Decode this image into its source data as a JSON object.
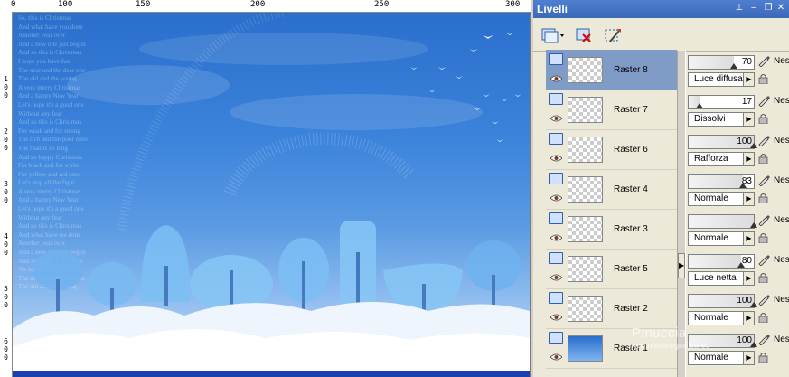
{
  "ruler": {
    "top_labels": [
      "0",
      "100",
      "150",
      "200",
      "250",
      "300"
    ],
    "left_labels": [
      "1\n0\n0",
      "2\n0\n0",
      "3\n0\n0",
      "4\n0\n0",
      "5\n0\n0",
      "6\n0\n0"
    ]
  },
  "canvas": {
    "poem_lines": [
      "So, this is Christmas",
      "And what have you done",
      "Another year over",
      "And a new one just begun",
      "And so this is Christmas",
      "I hope you have fun",
      "The near and the dear one",
      "The old and the young",
      "A very merry Christmas",
      "And a happy New Year",
      "Let's hope it's a good one",
      "Without any fear",
      "And so this is Christmas",
      "For weak and for strong",
      "The rich and the poor ones",
      "The road is so long",
      "And so happy Christmas",
      "For black and for white",
      "For yellow and red ones",
      "Let's stop all the fight",
      "A very merry Christmas",
      "And a happy New Year",
      "Let's hope it's a good one",
      "Without any fear",
      "And so this is Christmas",
      "And what have we done",
      "Another year over",
      "And a new one just begun",
      "And so happy Christmas",
      "We hope you have fun",
      "The near and the dear one",
      "The old and the young"
    ]
  },
  "panel": {
    "title": "Livelli",
    "toolbar": {
      "new_layer_icon": "new-layer-icon",
      "delete_icon": "delete-layer-icon",
      "edit_icon": "edit-selection-icon"
    },
    "layers": [
      {
        "name": "Raster 8",
        "selected": true,
        "opacity": "70",
        "opacity_value": 70,
        "blend": "Luce diffusa",
        "nes": "Nes",
        "thumb": "transparent"
      },
      {
        "name": "Raster 7",
        "selected": false,
        "opacity": "17",
        "opacity_value": 17,
        "blend": "Dissolvi",
        "nes": "Nes",
        "thumb": "transparent"
      },
      {
        "name": "Raster 6",
        "selected": false,
        "opacity": "100",
        "opacity_value": 100,
        "blend": "Rafforza",
        "nes": "Nes",
        "thumb": "transparent"
      },
      {
        "name": "Raster 4",
        "selected": false,
        "opacity": "83",
        "opacity_value": 83,
        "blend": "Normale",
        "nes": "Nes",
        "thumb": "transparent"
      },
      {
        "name": "Raster 3",
        "selected": false,
        "opacity": "",
        "opacity_value": 100,
        "blend": "Normale",
        "nes": "Nes",
        "thumb": "transparent"
      },
      {
        "name": "Raster 5",
        "selected": false,
        "opacity": "80",
        "opacity_value": 80,
        "blend": "Luce netta",
        "nes": "Nes",
        "thumb": "transparent"
      },
      {
        "name": "Raster 2",
        "selected": false,
        "opacity": "100",
        "opacity_value": 100,
        "blend": "Normale",
        "nes": "Nes",
        "thumb": "transparent"
      },
      {
        "name": "Raster 1",
        "selected": false,
        "opacity": "100",
        "opacity_value": 100,
        "blend": "Normale",
        "nes": "Nes",
        "thumb": "sky"
      }
    ]
  },
  "watermark": {
    "main": "Pinuccia",
    "sub": "www.maidiregrafica.eu"
  },
  "colors": {
    "panel_title": "#3a69b8",
    "selected_row": "#7f9cc6",
    "sky_top": "#2a6fcc",
    "sky_bottom": "#cfe2f8"
  }
}
